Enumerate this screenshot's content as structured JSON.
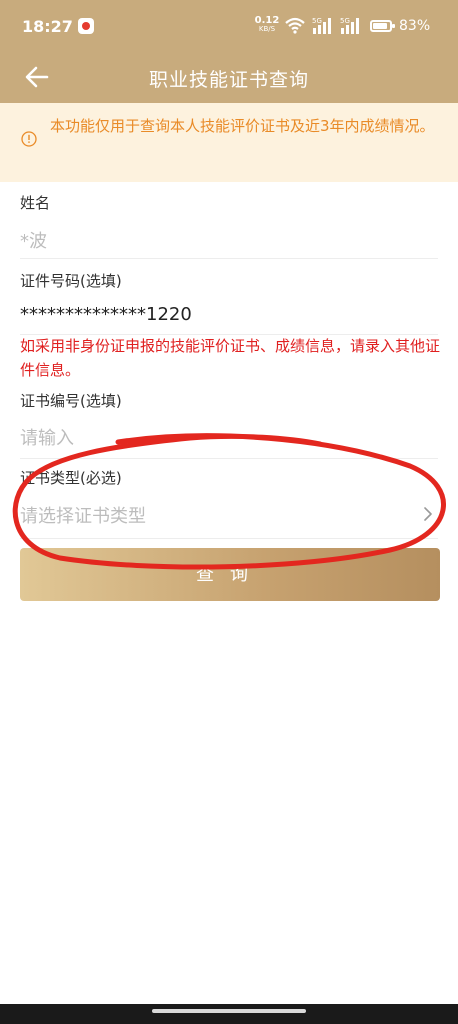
{
  "status_bar": {
    "time": "18:27",
    "net_speed_value": "0.12",
    "net_speed_unit": "KB/S",
    "sim1_label": "5G",
    "sim2_label": "5G",
    "battery": "83%"
  },
  "header": {
    "title": "职业技能证书查询"
  },
  "notice": {
    "text": "本功能仅用于查询本人技能评价证书及近3年内成绩情况。"
  },
  "form": {
    "name": {
      "label": "姓名",
      "value": "*波"
    },
    "id_number": {
      "label": "证件号码(选填)",
      "value": "**************1220"
    },
    "id_warning": "如采用非身份证申报的技能评价证书、成绩信息，请录入其他证件信息。",
    "cert_number": {
      "label": "证书编号(选填)",
      "placeholder": "请输入"
    },
    "cert_type": {
      "label": "证书类型(必选)",
      "placeholder": "请选择证书类型"
    },
    "submit_label": "查询"
  },
  "colors": {
    "header_bg": "#c8ab7d",
    "notice_bg": "#fdf2de",
    "notice_text": "#e98b28",
    "warning_text": "#e02020",
    "annotation_red": "#e3271f"
  },
  "icons": {
    "back": "back-arrow-icon",
    "notice": "info-circle-icon",
    "select": "chevron-right-icon"
  }
}
